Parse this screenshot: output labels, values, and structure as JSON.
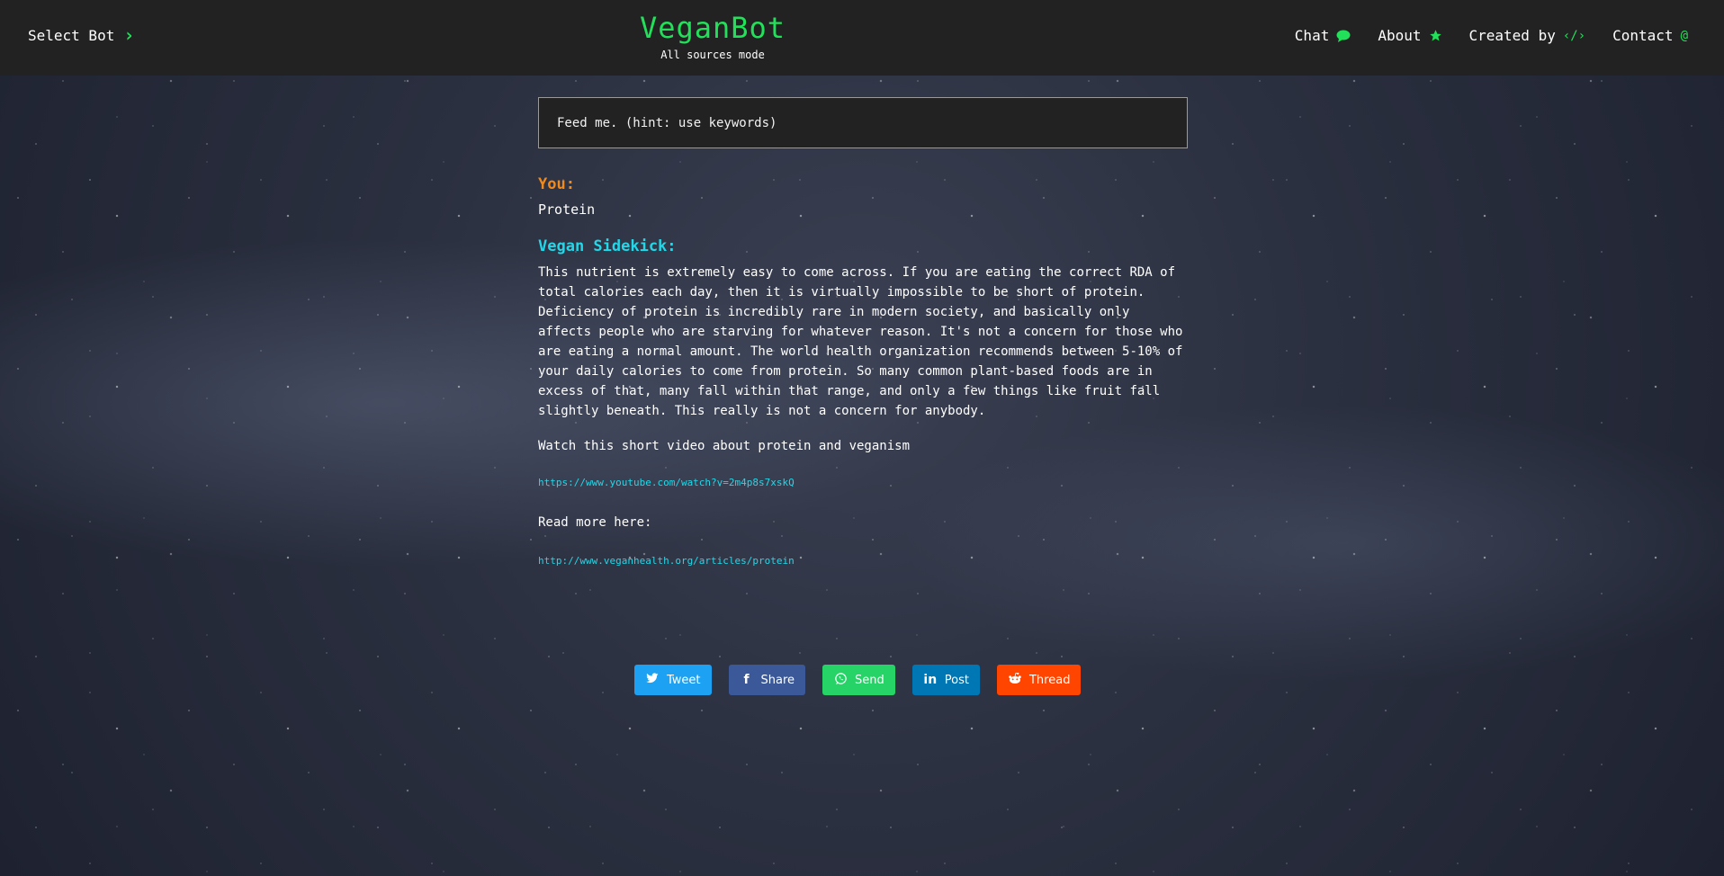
{
  "header": {
    "select_bot": "Select Bot",
    "brand": "VeganBot",
    "mode": "All sources mode",
    "nav": [
      {
        "label": "Chat",
        "icon": "chat-bubble-icon"
      },
      {
        "label": "About",
        "icon": "star-icon"
      },
      {
        "label": "Created by",
        "icon": "code-icon"
      },
      {
        "label": "Contact",
        "icon": "at-icon"
      }
    ]
  },
  "chat": {
    "input_placeholder": "Feed me. (hint: use keywords)",
    "you_label": "You:",
    "you_message": "Protein",
    "bot_label": "Vegan Sidekick:",
    "bot_message": "This nutrient is extremely easy to come across. If you are eating the correct RDA of total calories each day, then it is virtually impossible to be short of protein. Deficiency of protein is incredibly rare in modern society, and basically only affects people who are starving for whatever reason. It's not a concern for those who are eating a normal amount. The world health organization recommends between 5-10% of your daily calories to come from protein. So many common plant-based foods are in excess of that, many fall within that range, and only a few things like fruit fall slightly beneath. This really is not a concern for anybody.",
    "video_text": "Watch this short video about protein and veganism",
    "video_link": "https://www.youtube.com/watch?v=2m4p8s7xskQ",
    "read_more_text": "Read more here:",
    "read_more_link": "http://www.veganhealth.org/articles/protein"
  },
  "share": [
    {
      "label": "Tweet",
      "icon": "twitter-icon",
      "color": "#1da1f2"
    },
    {
      "label": "Share",
      "icon": "facebook-icon",
      "color": "#3b5998"
    },
    {
      "label": "Send",
      "icon": "whatsapp-icon",
      "color": "#25d366"
    },
    {
      "label": "Post",
      "icon": "linkedin-icon",
      "color": "#0077b5"
    },
    {
      "label": "Thread",
      "icon": "reddit-icon",
      "color": "#ff4500"
    }
  ],
  "colors": {
    "accent_green": "#22e05a",
    "user_orange": "#f08a1c",
    "bot_cyan": "#22d8e8",
    "header_bg": "#222222"
  }
}
